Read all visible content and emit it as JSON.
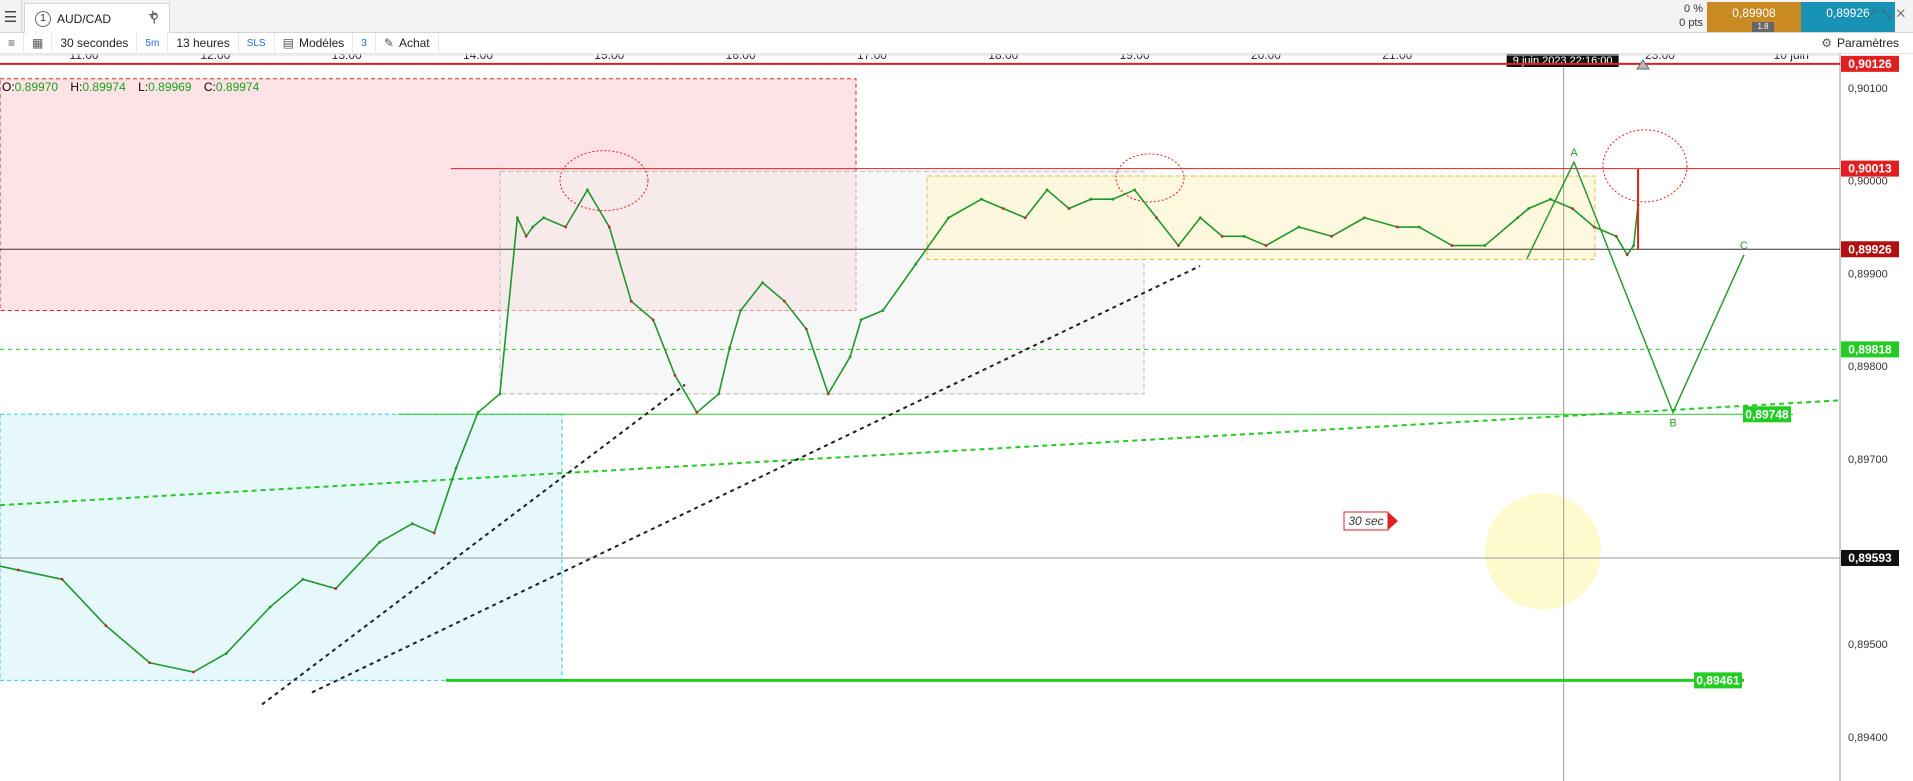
{
  "tabbar": {
    "menu_icon": "hamburger-icon",
    "tab": {
      "number": "1",
      "label": "AUD/CAD",
      "search_icon": "search-icon"
    },
    "add_icon": "plus-icon",
    "change_pct": "0 %",
    "change_pts": "0 pts",
    "bid": "0,89908",
    "spread": "1.8",
    "ask": "0,89926",
    "bid_color": "#c98a23",
    "ask_color": "#1993b5"
  },
  "toolbar": {
    "interval": "30 secondes",
    "interval_short": "5m",
    "period": "13 heures",
    "sls": "SLS",
    "models": "Modèles",
    "indicators_count": "3",
    "buy": "Achat",
    "settings": "Paramètres"
  },
  "ohlc": {
    "o_label": "O:",
    "o": "0.89970",
    "h_label": "H:",
    "h": "0.89974",
    "l_label": "L:",
    "l": "0.89969",
    "c_label": "C:",
    "c": "0.89974"
  },
  "chart_data": {
    "type": "line",
    "symbol": "AUD/CAD",
    "x_ticks": [
      "11:00",
      "12:00",
      "13:00",
      "14:00",
      "15:00",
      "16:00",
      "17:00",
      "18:00",
      "19:00",
      "20:00",
      "21:00",
      "22:00",
      "23:00",
      "10 juin"
    ],
    "cursor_time": "9 juin 2023 22:16:00",
    "y_ticks": [
      0.894,
      0.895,
      0.897,
      0.898,
      0.899,
      0.9,
      0.901
    ],
    "y_tick_labels": [
      "0,89400",
      "0,89500",
      "0,89700",
      "0,89800",
      "0,89900",
      "0,90000",
      "0,90100"
    ],
    "ylim": [
      0.8936,
      0.90128
    ],
    "series": [
      {
        "x": [
          "10:10",
          "10:30",
          "10:50",
          "11:10",
          "11:30",
          "11:50",
          "12:05",
          "12:25",
          "12:40",
          "12:55",
          "13:15",
          "13:30",
          "13:40",
          "13:50",
          "14:00",
          "14:10",
          "14:18",
          "14:22",
          "14:25",
          "14:30",
          "14:40",
          "14:50",
          "15:00",
          "15:10",
          "15:20",
          "15:30",
          "15:40",
          "15:50",
          "15:55",
          "16:00",
          "16:10",
          "16:20",
          "16:30",
          "16:40",
          "16:50",
          "16:55",
          "17:05",
          "17:20",
          "17:35",
          "17:50",
          "18:00",
          "18:10",
          "18:20",
          "18:30",
          "18:40",
          "18:50",
          "19:00",
          "19:10",
          "19:20",
          "19:30",
          "19:40",
          "19:50",
          "20:00",
          "20:15",
          "20:30",
          "20:45",
          "21:00",
          "21:10",
          "21:25",
          "21:40",
          "21:55",
          "22:00",
          "22:10",
          "22:20",
          "22:30",
          "22:40",
          "22:45",
          "22:48",
          "22:50"
        ],
        "y": [
          0.8959,
          0.8958,
          0.8957,
          0.8952,
          0.8948,
          0.8947,
          0.8949,
          0.8954,
          0.8957,
          0.8956,
          0.8961,
          0.8963,
          0.8962,
          0.8969,
          0.8975,
          0.8977,
          0.8996,
          0.8994,
          0.8995,
          0.8996,
          0.8995,
          0.8999,
          0.8995,
          0.8987,
          0.8985,
          0.8979,
          0.8975,
          0.8977,
          0.8982,
          0.8986,
          0.8989,
          0.8987,
          0.8984,
          0.8977,
          0.8981,
          0.8985,
          0.8986,
          0.8991,
          0.8996,
          0.8998,
          0.8997,
          0.8996,
          0.8999,
          0.8997,
          0.8998,
          0.8998,
          0.8999,
          0.8996,
          0.8993,
          0.8996,
          0.8994,
          0.8994,
          0.8993,
          0.8995,
          0.8994,
          0.8996,
          0.8995,
          0.8995,
          0.8993,
          0.8993,
          0.8996,
          0.8997,
          0.8998,
          0.8997,
          0.8995,
          0.8994,
          0.8992,
          0.8993,
          0.89974
        ]
      }
    ],
    "horizontal_levels": [
      {
        "value": 0.90126,
        "label": "0,90126",
        "color": "#e02020"
      },
      {
        "value": 0.90013,
        "label": "0,90013",
        "color": "#e02020"
      },
      {
        "value": 0.89926,
        "label": "0,89926",
        "color": "#b01010"
      },
      {
        "value": 0.89818,
        "label": "0,89818",
        "color": "#22cc22"
      },
      {
        "value": 0.89748,
        "label": "0,89748",
        "color": "#22cc22"
      },
      {
        "value": 0.89593,
        "label": "0,89593",
        "color": "#111111"
      },
      {
        "value": 0.89461,
        "label": "0,89461",
        "color": "#22cc22"
      }
    ],
    "abc_pattern": {
      "labels": [
        "A",
        "B",
        "C"
      ],
      "y": [
        0.9002,
        0.8975,
        0.8992
      ],
      "color": "#2e9a2e"
    },
    "annotation": "30 sec"
  }
}
